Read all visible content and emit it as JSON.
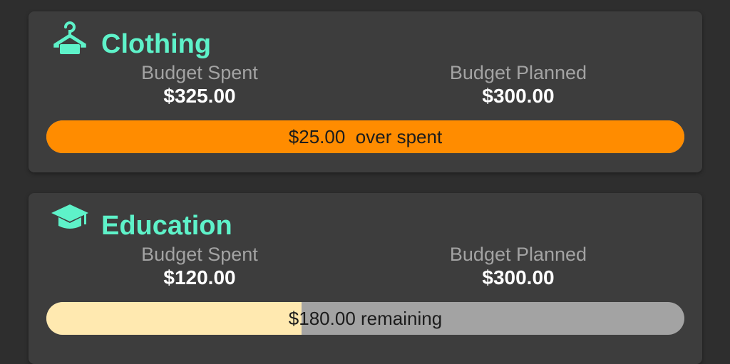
{
  "colors": {
    "accent": "#5ef2c9",
    "over_budget": "#ff8c00",
    "within_budget": "#ffe9b0",
    "track": "#a3a3a3"
  },
  "categories": [
    {
      "name": "Clothing",
      "icon": "hanger-icon",
      "spent_label": "Budget Spent",
      "spent_value": "$325.00",
      "planned_label": "Budget Planned",
      "planned_value": "$300.00",
      "status_text": "$25.00  over spent",
      "fill_fraction": 1.0,
      "over_budget": true
    },
    {
      "name": "Education",
      "icon": "graduation-cap-icon",
      "spent_label": "Budget Spent",
      "spent_value": "$120.00",
      "planned_label": "Budget Planned",
      "planned_value": "$300.00",
      "status_text": "$180.00 remaining",
      "fill_fraction": 0.4,
      "over_budget": false
    }
  ]
}
